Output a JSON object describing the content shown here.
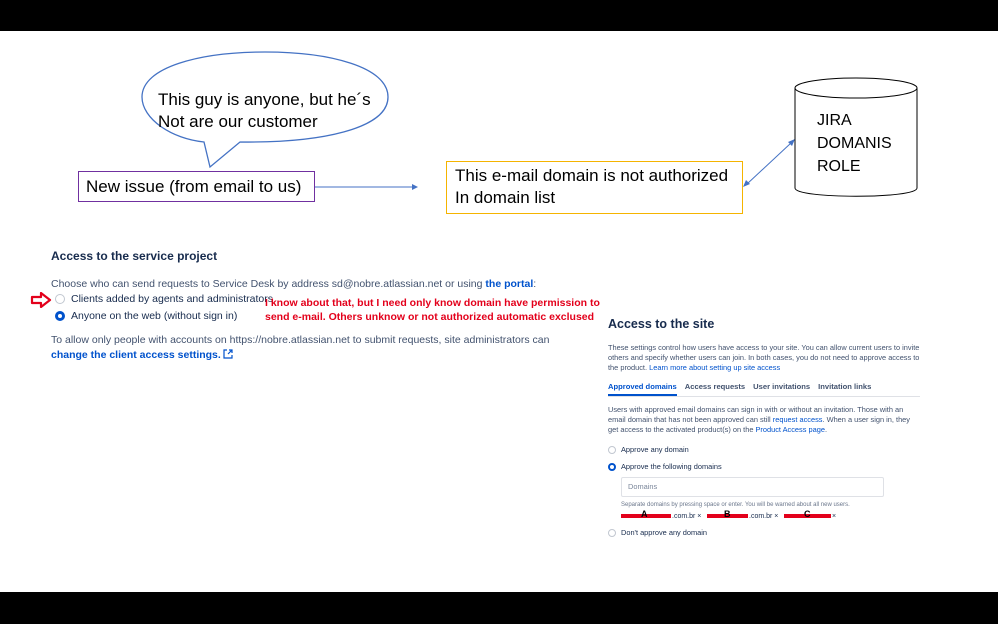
{
  "annotations": {
    "bubble": "This guy is anyone, but he´s Not are our customer",
    "new_issue": "New issue (from email to us)",
    "domain_box": "This e-mail domain is not authorized In domain list",
    "jira_cylinder": "JIRA DOMANIS ROLE",
    "red_note": "I know about that, but I need only know domain have permission to send e-mail. Others unknow or not authorized automatic exclused",
    "colors": {
      "purple_box": "#7030a0",
      "yellow_box": "#f5b400",
      "arrow_blue": "#4472c4",
      "red": "#e3001b"
    }
  },
  "service_project": {
    "title": "Access to the service project",
    "desc_prefix": "Choose who can send requests to Service Desk by address sd@nobre.atlassian.net or using",
    "desc_link": "the portal",
    "desc_suffix": ":",
    "option_1": "Clients added by agents and administrators",
    "option_2": "Anyone on the web (without sign in)",
    "allow_text": "To allow only people with accounts on https://nobre.atlassian.net to submit requests, site administrators can",
    "allow_link": "change the client access settings."
  },
  "site_access": {
    "title": "Access to the site",
    "desc": "These settings control how users have access to your site. You can allow current users to invite others and specify whether users can join. In both cases, you do not need to approve access to the product.",
    "desc_link": "Learn more about setting up site access",
    "tabs": [
      "Approved domains",
      "Access requests",
      "User invitations",
      "Invitation links"
    ],
    "approved_desc_1": "Users with approved email domains can sign in with or without an invitation. Those with an email domain that has not been approved can still",
    "approved_link_1": "request access",
    "approved_desc_2": ". When a user sign in, they get access to the activated product(s) on the",
    "approved_link_2": "Product Access page",
    "approved_desc_3": ".",
    "option_any": "Approve any domain",
    "option_following": "Approve the following domains",
    "domains_placeholder": "Domains",
    "hint": "Separate domains by pressing space or enter. You will be warned about all new users.",
    "chips": [
      {
        "letter": "A",
        "suffix": ".com.br ×"
      },
      {
        "letter": "B",
        "suffix": ".com.br ×"
      },
      {
        "letter": "C",
        "suffix": "×"
      }
    ],
    "option_none": "Don't approve any domain"
  }
}
